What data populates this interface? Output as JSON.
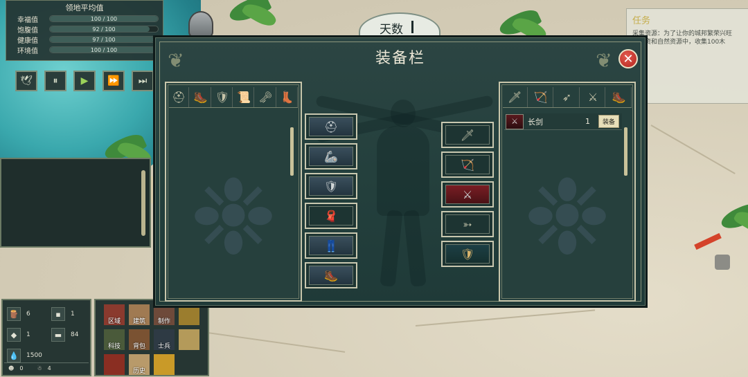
{
  "stats": {
    "title": "领地平均值",
    "rows": [
      {
        "label": "幸福值",
        "value": "100 / 100",
        "fraction": 1.0
      },
      {
        "label": "饱腹值",
        "value": "92 / 100",
        "fraction": 0.92
      },
      {
        "label": "健康值",
        "value": "97 / 100",
        "fraction": 0.97
      },
      {
        "label": "环境值",
        "value": "100 / 100",
        "fraction": 1.0
      }
    ]
  },
  "speed_controls": [
    {
      "name": "speed-dove-button",
      "icon": "🕊"
    },
    {
      "name": "pause-button",
      "icon": "⏸"
    },
    {
      "name": "play-button",
      "icon": "▶"
    },
    {
      "name": "fast-forward-button",
      "icon": "⏩"
    },
    {
      "name": "fastest-button",
      "icon": "⏭"
    }
  ],
  "day": {
    "label": "天数"
  },
  "task": {
    "title": "任务",
    "text": "采集资源：为了让你的城邦繁荣兴旺\n给物资和自然资源中，收集100木\n石头"
  },
  "inventory": {
    "items": [
      {
        "name": "wood",
        "icon": "🪵",
        "count": "6"
      },
      {
        "name": "stone",
        "icon": "▪",
        "count": "1"
      },
      {
        "name": "ore",
        "icon": "◆",
        "count": "1"
      },
      {
        "name": "brick",
        "icon": "▬",
        "count": "84"
      },
      {
        "name": "water",
        "icon": "💧",
        "count": "1500"
      }
    ],
    "footer": [
      {
        "icon": "☻",
        "count": "0"
      },
      {
        "icon": "☃",
        "count": "4"
      }
    ]
  },
  "build_menu": {
    "items": [
      "区域",
      "建筑",
      "制作",
      "",
      "科技",
      "背包",
      "士兵",
      "",
      "",
      "历史",
      "",
      ""
    ]
  },
  "equipment": {
    "title": "装备栏",
    "close_icon": "✕",
    "left_tabs": [
      "⛑",
      "🥾",
      "🛡",
      "📜",
      "🗝",
      "👢"
    ],
    "right_tabs": [
      "🗡",
      "🏹",
      "➶",
      "⚔",
      "🥾"
    ],
    "left_slots": [
      {
        "name": "helmet-slot",
        "icon": "⛑"
      },
      {
        "name": "arm-armor-slot",
        "icon": "🦾"
      },
      {
        "name": "body-armor-slot",
        "icon": "🛡"
      },
      {
        "name": "cloak-slot",
        "icon": "🧣"
      },
      {
        "name": "leg-armor-slot",
        "icon": "👖"
      },
      {
        "name": "boots-slot",
        "icon": "🥾"
      }
    ],
    "right_slots": [
      {
        "name": "dagger-slot",
        "icon": "🗡"
      },
      {
        "name": "bow-slot",
        "icon": "🏹"
      },
      {
        "name": "sword-slot",
        "icon": "⚔"
      },
      {
        "name": "crossbow-slot",
        "icon": "➳"
      },
      {
        "name": "shield-slot",
        "icon": "🛡"
      }
    ],
    "weapon_list": [
      {
        "name": "长剑",
        "count": "1",
        "button": "装备"
      }
    ]
  }
}
